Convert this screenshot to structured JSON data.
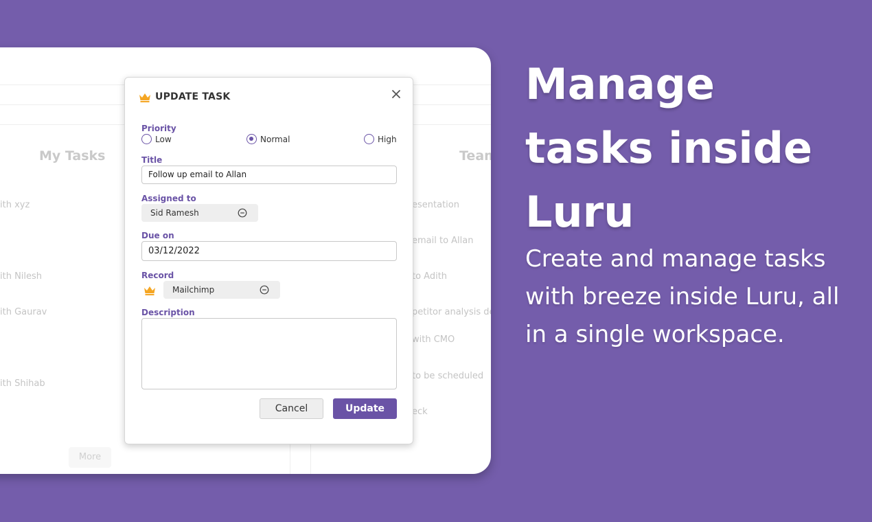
{
  "background_app": {
    "columns": [
      {
        "heading": "My Tasks",
        "items": [
          "ith xyz",
          "ith Nilesh",
          "ith Gaurav",
          "ith Shihab"
        ],
        "more_label": "More"
      },
      {
        "heading": "Team",
        "items": [
          "esentation",
          "email to Allan",
          "to Adith",
          "petitor analysis de",
          "with CMO",
          "to be scheduled",
          "eck"
        ]
      }
    ]
  },
  "modal": {
    "title": "UPDATE TASK",
    "priority": {
      "label": "Priority",
      "options": [
        "Low",
        "Normal",
        "High"
      ],
      "selected": "Normal"
    },
    "title_field": {
      "label": "Title",
      "value": "Follow up email to Allan"
    },
    "assigned_to": {
      "label": "Assigned to",
      "value": "Sid Ramesh"
    },
    "due_on": {
      "label": "Due on",
      "value": "03/12/2022"
    },
    "record": {
      "label": "Record",
      "value": "Mailchimp"
    },
    "description": {
      "label": "Description",
      "value": ""
    },
    "cancel_label": "Cancel",
    "update_label": "Update"
  },
  "hero": {
    "heading": "Manage tasks inside Luru",
    "subheading": "Create and manage tasks with breeze inside Luru, all in a single workspace."
  },
  "colors": {
    "background": "#745DAB",
    "accent": "#6A53A6",
    "crown": "#F5A623"
  },
  "icons": [
    "crown-icon",
    "close-icon",
    "remove-icon"
  ]
}
